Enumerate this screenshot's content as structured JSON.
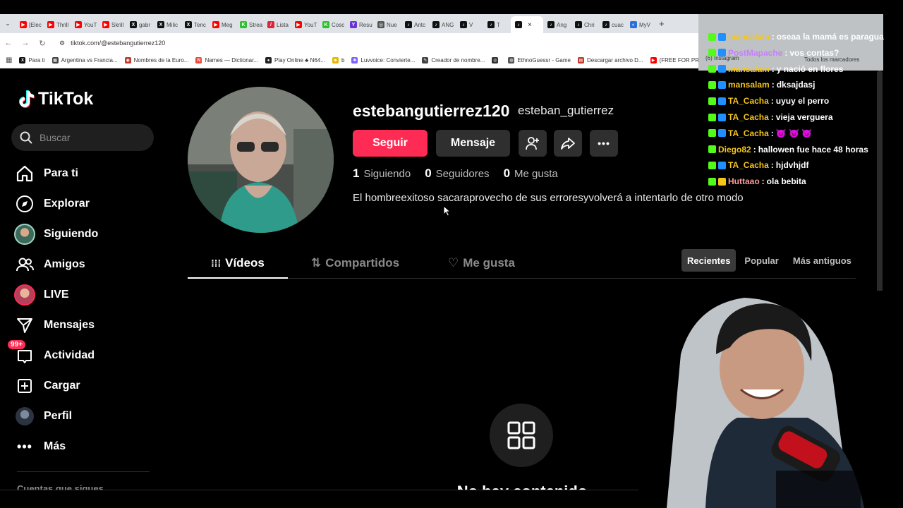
{
  "browser": {
    "tabs": [
      {
        "label": "[Elec",
        "color": "#ff0000",
        "glyph": "▶"
      },
      {
        "label": "Thrill",
        "color": "#ff0000",
        "glyph": "▶"
      },
      {
        "label": "YouT",
        "color": "#ff0000",
        "glyph": "▶"
      },
      {
        "label": "Skrill",
        "color": "#ff0000",
        "glyph": "▶"
      },
      {
        "label": "gabr",
        "color": "#111111",
        "glyph": "X"
      },
      {
        "label": "Milic",
        "color": "#111111",
        "glyph": "X"
      },
      {
        "label": "Tenc",
        "color": "#111111",
        "glyph": "X"
      },
      {
        "label": "Meg",
        "color": "#ff0000",
        "glyph": "▶"
      },
      {
        "label": "Strea",
        "color": "#2fbf2f",
        "glyph": "K"
      },
      {
        "label": "Lista",
        "color": "#d8263b",
        "glyph": "/"
      },
      {
        "label": "YouT",
        "color": "#ff0000",
        "glyph": "▶"
      },
      {
        "label": "Cosc",
        "color": "#2fbf2f",
        "glyph": "K"
      },
      {
        "label": "Resu",
        "color": "#6a34d4",
        "glyph": "Y"
      },
      {
        "label": "Nue",
        "color": "#555555",
        "glyph": "◎"
      },
      {
        "label": "Antc",
        "color": "#111111",
        "glyph": "♪"
      },
      {
        "label": "ANG",
        "color": "#111111",
        "glyph": "♪"
      },
      {
        "label": "V",
        "color": "#111111",
        "glyph": "♪"
      },
      {
        "label": "T",
        "color": "#111111",
        "glyph": "♪"
      },
      {
        "label": "",
        "color": "#111111",
        "glyph": "♪",
        "active": true
      },
      {
        "label": "Ang",
        "color": "#111111",
        "glyph": "♪"
      },
      {
        "label": "Chri",
        "color": "#111111",
        "glyph": "♪"
      },
      {
        "label": "cuac",
        "color": "#111111",
        "glyph": "♪"
      },
      {
        "label": "MyV",
        "color": "#2a6fdb",
        "glyph": "◐"
      }
    ],
    "tab_close": "×",
    "new_tab": "+",
    "url": "tiktok.com/@estebangutierrez120",
    "bookmarks": [
      {
        "label": "Para ti",
        "color": "#111111",
        "glyph": "X"
      },
      {
        "label": "Argentina vs Francia...",
        "color": "#444444",
        "glyph": "▦"
      },
      {
        "label": "Nombres de la Euro...",
        "color": "#c0392b",
        "glyph": "◉"
      },
      {
        "label": "Names — Dictionar...",
        "color": "#e74c3c",
        "glyph": "N"
      },
      {
        "label": "Play Online ♣ N64...",
        "color": "#222222",
        "glyph": "●"
      },
      {
        "label": "b",
        "color": "#e6b800",
        "glyph": "☻"
      },
      {
        "label": "Luvvoice: Convierte...",
        "color": "#7b61ff",
        "glyph": "✱"
      },
      {
        "label": "Creador de nombre...",
        "color": "#444444",
        "glyph": "✎"
      },
      {
        "label": "",
        "color": "#333333",
        "glyph": "◎"
      },
      {
        "label": "EthnoGuessr - Game",
        "color": "#555555",
        "glyph": "◍"
      },
      {
        "label": "Descargar archivo D...",
        "color": "#c0392b",
        "glyph": "▤"
      },
      {
        "label": "(FREE FOR PROFIT)",
        "color": "#ff0000",
        "glyph": "▶"
      }
    ],
    "instagram_bookmark": "(6) Instagram",
    "all_bookmarks": "Todos los marcadores"
  },
  "sidebar": {
    "logo_text": "TikTok",
    "search_placeholder": "Buscar",
    "items": [
      {
        "label": "Para ti",
        "icon": "home-icon"
      },
      {
        "label": "Explorar",
        "icon": "compass-icon"
      },
      {
        "label": "Siguiendo",
        "icon": "following-avatar-icon"
      },
      {
        "label": "Amigos",
        "icon": "friends-icon"
      },
      {
        "label": "LIVE",
        "icon": "live-avatar-icon"
      },
      {
        "label": "Mensajes",
        "icon": "send-icon"
      },
      {
        "label": "Actividad",
        "icon": "inbox-icon"
      },
      {
        "label": "Cargar",
        "icon": "upload-icon"
      },
      {
        "label": "Perfil",
        "icon": "profile-avatar-icon"
      },
      {
        "label": "Más",
        "icon": "more-icon"
      }
    ],
    "activity_badge": "99+",
    "following_caption": "Cuentas que sigues"
  },
  "profile": {
    "username": "estebangutierrez120",
    "nickname": "esteban_gutierrez",
    "follow_label": "Seguir",
    "message_label": "Mensaje",
    "stats": {
      "following_count": "1",
      "following_label": "Siguiendo",
      "followers_count": "0",
      "followers_label": "Seguidores",
      "likes_count": "0",
      "likes_label": "Me gusta"
    },
    "bio": "El hombreexitoso sacaraprovecho de sus erroresyvolverá a intentarlo de otro modo"
  },
  "content_tabs": {
    "videos": "Vídeos",
    "reposts": "Compartidos",
    "liked": "Me gusta"
  },
  "sort": {
    "recent": "Recientes",
    "popular": "Popular",
    "oldest": "Más antiguos"
  },
  "empty_state": {
    "title": "No hay contenido"
  },
  "chat": {
    "messages": [
      {
        "user": "mansalam",
        "text": "oseaa la mamá es paragua",
        "color": "#f5c518"
      },
      {
        "user": "PostMapache",
        "text": "vos contas?",
        "color": "#c77dff"
      },
      {
        "user": "mansalam",
        "text": "y nació en flores",
        "color": "#f5c518"
      },
      {
        "user": "mansalam",
        "text": "dksajdasj",
        "color": "#f5c518"
      },
      {
        "user": "TA_Cacha",
        "text": "uyuy el perro",
        "color": "#f5c518"
      },
      {
        "user": "TA_Cacha",
        "text": "vieja verguera",
        "color": "#f5c518"
      },
      {
        "user": "TA_Cacha",
        "text": "👿 👿 👿",
        "color": "#f5c518"
      },
      {
        "user": "Diego82",
        "text": "hallowen fue hace 48 horas",
        "color": "#f5c518"
      },
      {
        "user": "TA_Cacha",
        "text": "hjdvhjdf",
        "color": "#f5c518"
      },
      {
        "user": "Huttaao",
        "text": "ola bebita",
        "color": "#ff9a9a"
      }
    ]
  },
  "colors": {
    "accent": "#fe2c55",
    "background": "#000000",
    "button_dark": "#2f2f2f"
  }
}
